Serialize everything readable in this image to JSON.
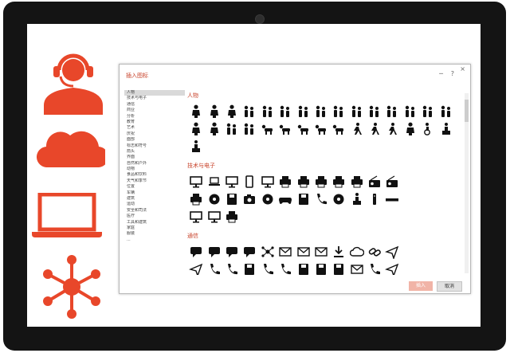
{
  "colors": {
    "accent": "#e8472a",
    "glyph": "#111111"
  },
  "dialog": {
    "title": "插入图标",
    "minimize_label": "─",
    "help_label": "?",
    "close_label": "×",
    "insert_button": "插入",
    "cancel_button": "取消"
  },
  "categories": [
    "人物",
    "技术与电子",
    "通信",
    "商业",
    "分析",
    "教育",
    "艺术",
    "庆祝",
    "面部",
    "标志和符号",
    "箭头",
    "界面",
    "自然和户外",
    "动物",
    "食品和饮料",
    "天气和季节",
    "位置",
    "车辆",
    "建筑",
    "运动",
    "安全和司法",
    "医疗",
    "工具和建筑",
    "家庭",
    "服装",
    "..."
  ],
  "sections": [
    {
      "title": "人物",
      "icons": [
        [
          "person",
          "person",
          "person-bust",
          "group-3",
          "group-3",
          "meeting",
          "family",
          "couple",
          "family",
          "family",
          "couple",
          "family",
          "family",
          "family",
          "family-2"
        ],
        [
          "child",
          "elderly",
          "family",
          "family",
          "baby",
          "crawling",
          "kneeling",
          "dog-walker",
          "crawling",
          "walking",
          "running",
          "running",
          "elderly-walker",
          "wheelchair",
          "speaker"
        ],
        [
          "teacher-board"
        ]
      ]
    },
    {
      "title": "技术与电子",
      "icons": [
        [
          "desktop",
          "laptop",
          "monitor",
          "tablet",
          "tv",
          "printer",
          "fax",
          "printer",
          "projector",
          "scanner",
          "wifi-router",
          "radio"
        ],
        [
          "cash-register",
          "disc",
          "floppy",
          "camera",
          "webcam",
          "gamepad",
          "cable",
          "headphones",
          "record",
          "speakers",
          "remote",
          "keyboard"
        ],
        [
          "monitor-stand",
          "projection-screen",
          "projector"
        ]
      ]
    },
    {
      "title": "通信",
      "icons": [
        [
          "speech-bubble",
          "conversation",
          "speech-bubble",
          "thought-bubble",
          "network",
          "envelope",
          "mail-open",
          "mail-open",
          "download",
          "cloud",
          "chain-link",
          "paper-plane"
        ],
        [
          "share-arrow",
          "phone",
          "telephone",
          "usb",
          "microphone",
          "megaphone",
          "satellite",
          "receipt",
          "sign",
          "mailbox",
          "phone-call",
          "send"
        ]
      ]
    }
  ]
}
